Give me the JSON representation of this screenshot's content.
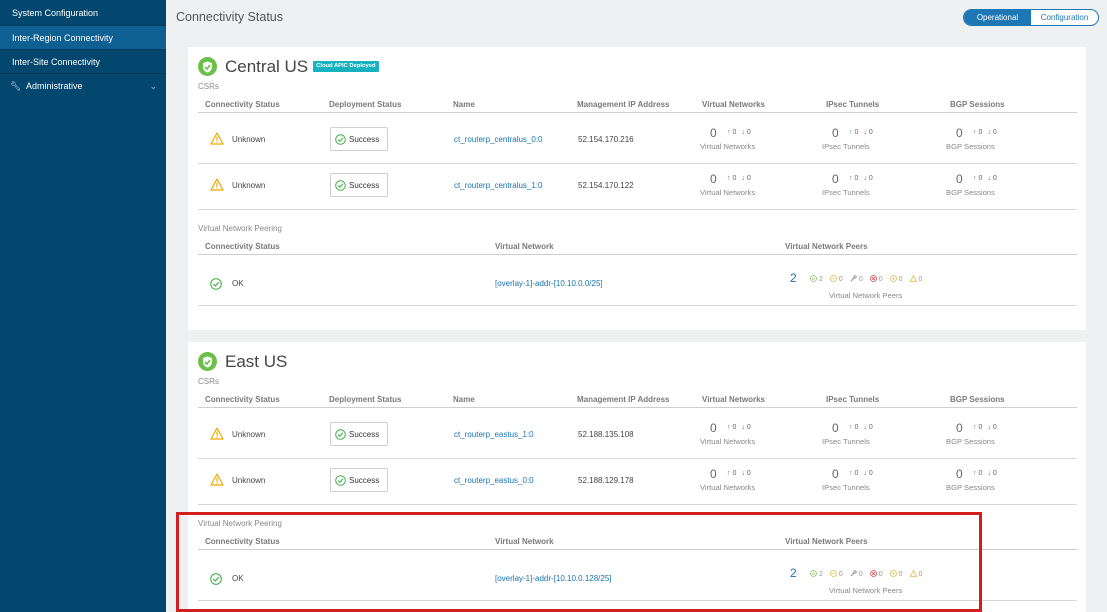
{
  "sidebar": {
    "items": [
      {
        "label": "System Configuration"
      },
      {
        "label": "Inter-Region Connectivity"
      },
      {
        "label": "Inter-Site Connectivity"
      },
      {
        "label": "Administrative"
      }
    ]
  },
  "header": {
    "title": "Connectivity Status",
    "toggle": {
      "operational": "Operational",
      "configuration": "Configuration"
    }
  },
  "common": {
    "csrs_label": "CSRs",
    "vnp_label": "Virtual Network Peering",
    "columns": {
      "conn": "Connectivity Status",
      "deploy": "Deployment Status",
      "name": "Name",
      "mgmt": "Management IP Address",
      "vnets": "Virtual Networks",
      "ipsec": "IPsec Tunnels",
      "bgp": "BGP Sessions"
    },
    "peer_columns": {
      "conn": "Connectivity Status",
      "vnet": "Virtual Network",
      "peers": "Virtual Network Peers"
    }
  },
  "regions": [
    {
      "name": "Central US",
      "badge": "Cloud APIC Deployed",
      "csrs": [
        {
          "status": "Unknown",
          "deploy": "Success",
          "name": "ct_routerp_centralus_0:0",
          "ip": "52.154.170.216",
          "vnets": {
            "num": "0",
            "up": "0",
            "dn": "0",
            "cap": "Virtual Networks"
          },
          "ipsec": {
            "num": "0",
            "up": "0",
            "dn": "0",
            "cap": "IPsec Tunnels"
          },
          "bgp": {
            "num": "0",
            "up": "0",
            "dn": "0",
            "cap": "BGP Sessions"
          }
        },
        {
          "status": "Unknown",
          "deploy": "Success",
          "name": "ct_routerp_centralus_1:0",
          "ip": "52.154.170.122",
          "vnets": {
            "num": "0",
            "up": "0",
            "dn": "0",
            "cap": "Virtual Networks"
          },
          "ipsec": {
            "num": "0",
            "up": "0",
            "dn": "0",
            "cap": "IPsec Tunnels"
          },
          "bgp": {
            "num": "0",
            "up": "0",
            "dn": "0",
            "cap": "BGP Sessions"
          }
        }
      ],
      "peering": {
        "status": "OK",
        "vnet": "[overlay-1]-addr-[10.10.0.0/25]",
        "peers": "2",
        "stats": [
          "2",
          "0",
          "0",
          "0",
          "0",
          "0"
        ],
        "cap": "Virtual Network Peers"
      }
    },
    {
      "name": "East US",
      "badge": "",
      "csrs": [
        {
          "status": "Unknown",
          "deploy": "Success",
          "name": "ct_routerp_eastus_1:0",
          "ip": "52.188.135.108",
          "vnets": {
            "num": "0",
            "up": "0",
            "dn": "0",
            "cap": "Virtual Networks"
          },
          "ipsec": {
            "num": "0",
            "up": "0",
            "dn": "0",
            "cap": "IPsec Tunnels"
          },
          "bgp": {
            "num": "0",
            "up": "0",
            "dn": "0",
            "cap": "BGP Sessions"
          }
        },
        {
          "status": "Unknown",
          "deploy": "Success",
          "name": "ct_routerp_eastus_0:0",
          "ip": "52.188.129.178",
          "vnets": {
            "num": "0",
            "up": "0",
            "dn": "0",
            "cap": "Virtual Networks"
          },
          "ipsec": {
            "num": "0",
            "up": "0",
            "dn": "0",
            "cap": "IPsec Tunnels"
          },
          "bgp": {
            "num": "0",
            "up": "0",
            "dn": "0",
            "cap": "BGP Sessions"
          }
        }
      ],
      "peering": {
        "status": "OK",
        "vnet": "[overlay-1]-addr-[10.10.0.128/25]",
        "peers": "2",
        "stats": [
          "2",
          "0",
          "0",
          "0",
          "0",
          "0"
        ],
        "cap": "Virtual Network Peers"
      }
    }
  ],
  "colors": {
    "sidebar": "#03476e",
    "accent": "#1e77b5",
    "ok": "#6cc04a",
    "warn": "#f0a800",
    "badge": "#17b2c0",
    "highlight": "#d21e1e"
  },
  "icons": {
    "region": "shield-check-icon",
    "warn": "warning-triangle-icon",
    "success": "check-circle-icon",
    "ok": "check-circle-icon"
  }
}
